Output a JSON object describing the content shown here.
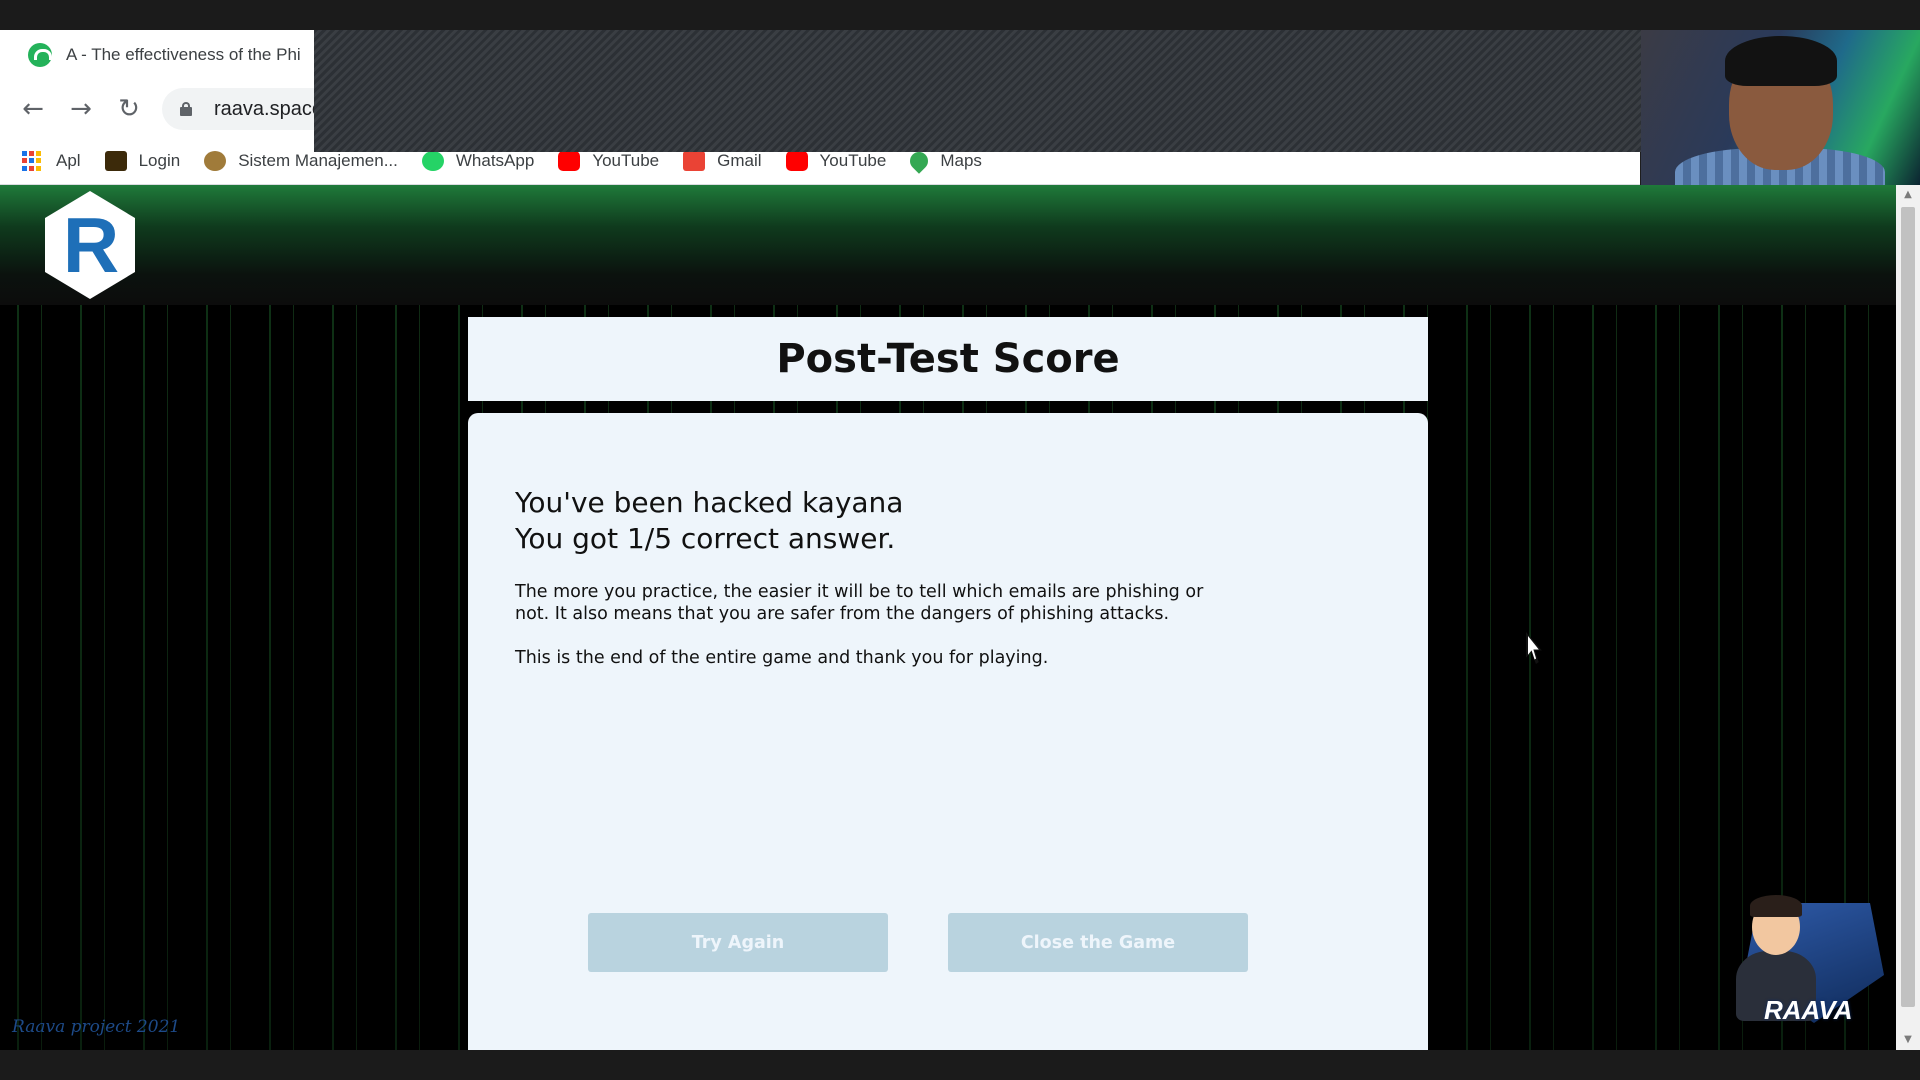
{
  "browser": {
    "tab_title": "A - The effectiveness of the Phi",
    "address": "raava.space",
    "bookmarks": [
      {
        "label": "Apl",
        "icon": "apps-grid-icon"
      },
      {
        "label": "Login",
        "icon": "login-favicon-icon",
        "color": "#3c2a0a"
      },
      {
        "label": "Sistem Manajemen...",
        "icon": "bike-favicon-icon",
        "color": "#a07b3a"
      },
      {
        "label": "WhatsApp",
        "icon": "whatsapp-icon",
        "color": "#25d366"
      },
      {
        "label": "YouTube",
        "icon": "youtube-icon",
        "color": "#ff0000"
      },
      {
        "label": "Gmail",
        "icon": "gmail-icon",
        "color": "#ea4335"
      },
      {
        "label": "YouTube",
        "icon": "youtube-icon",
        "color": "#ff0000"
      },
      {
        "label": "Maps",
        "icon": "maps-pin-icon",
        "color": "#34a853"
      }
    ]
  },
  "page": {
    "title": "Post-Test Score",
    "headline_1": "You've been hacked kayana",
    "headline_2": "You got 1/5 correct answer.",
    "paragraph_1": "The more you practice, the easier it will be to tell which emails are phishing or not. It also means that you are safer from the dangers of phishing attacks.",
    "paragraph_2": "This is the end of the entire game and thank you for playing.",
    "try_again_label": "Try Again",
    "close_label": "Close the Game",
    "footer_credit": "Raava project 2021",
    "mascot_brand": "RAAVA"
  },
  "colors": {
    "card_bg": "#eef5fb",
    "button_bg": "#b9d3df",
    "logo_blue": "#1e6fb8",
    "header_green": "#1f7a3a"
  }
}
